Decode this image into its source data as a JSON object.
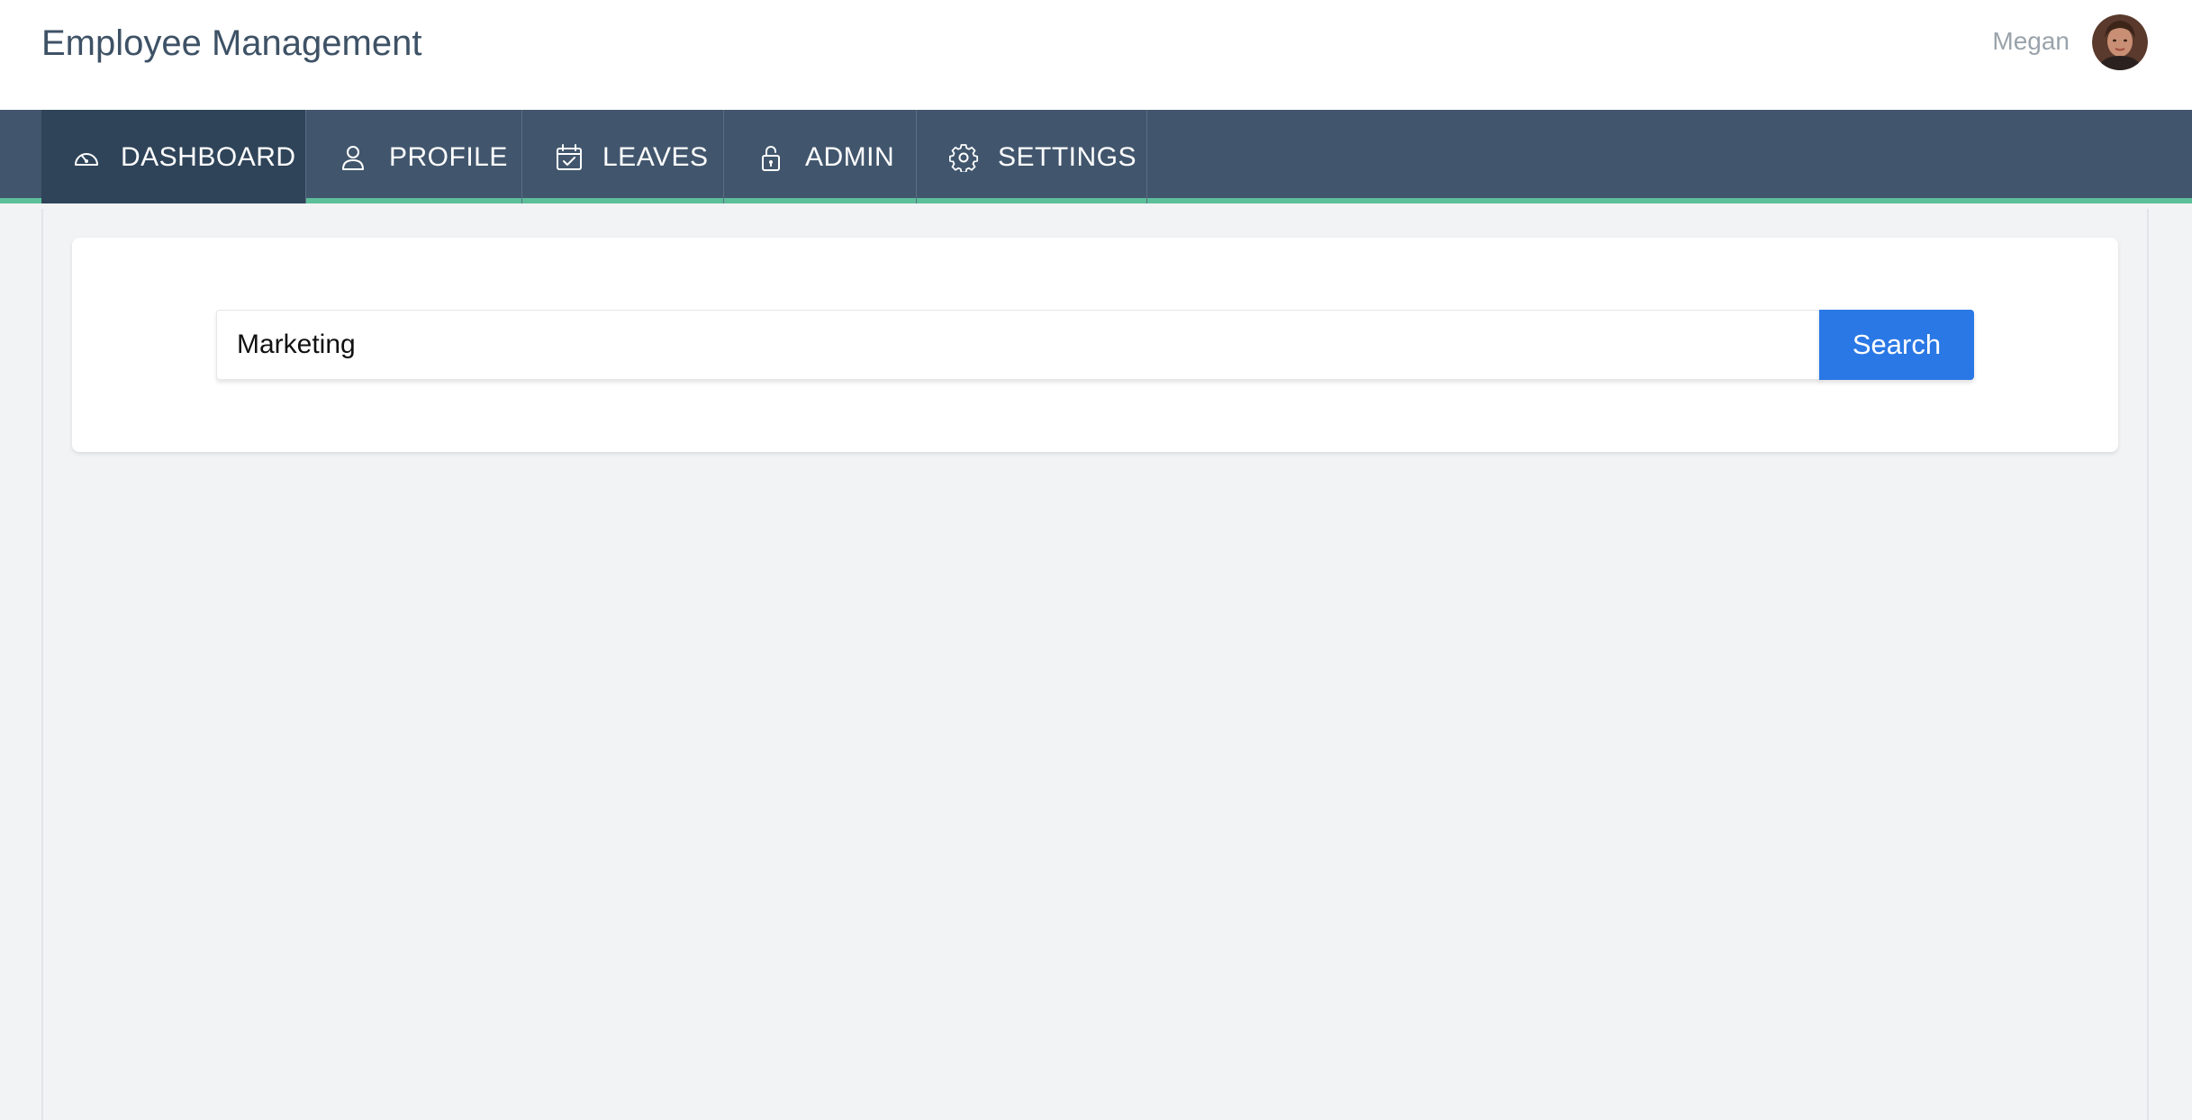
{
  "header": {
    "app_title": "Employee Management",
    "user_name": "Megan"
  },
  "nav": {
    "items": [
      {
        "label": "DASHBOARD",
        "icon": "dashboard-gauge-icon",
        "active": true
      },
      {
        "label": "PROFILE",
        "icon": "user-icon",
        "active": false
      },
      {
        "label": "LEAVES",
        "icon": "calendar-check-icon",
        "active": false
      },
      {
        "label": "ADMIN",
        "icon": "lock-icon",
        "active": false
      },
      {
        "label": "SETTINGS",
        "icon": "gear-icon",
        "active": false
      }
    ]
  },
  "search": {
    "value": "Marketing",
    "button_label": "Search"
  },
  "colors": {
    "nav_background": "#41566d",
    "nav_active": "#2f4459",
    "nav_underline": "#5dbf9a",
    "primary_button": "#2a78e5",
    "page_background": "#f2f3f5"
  }
}
